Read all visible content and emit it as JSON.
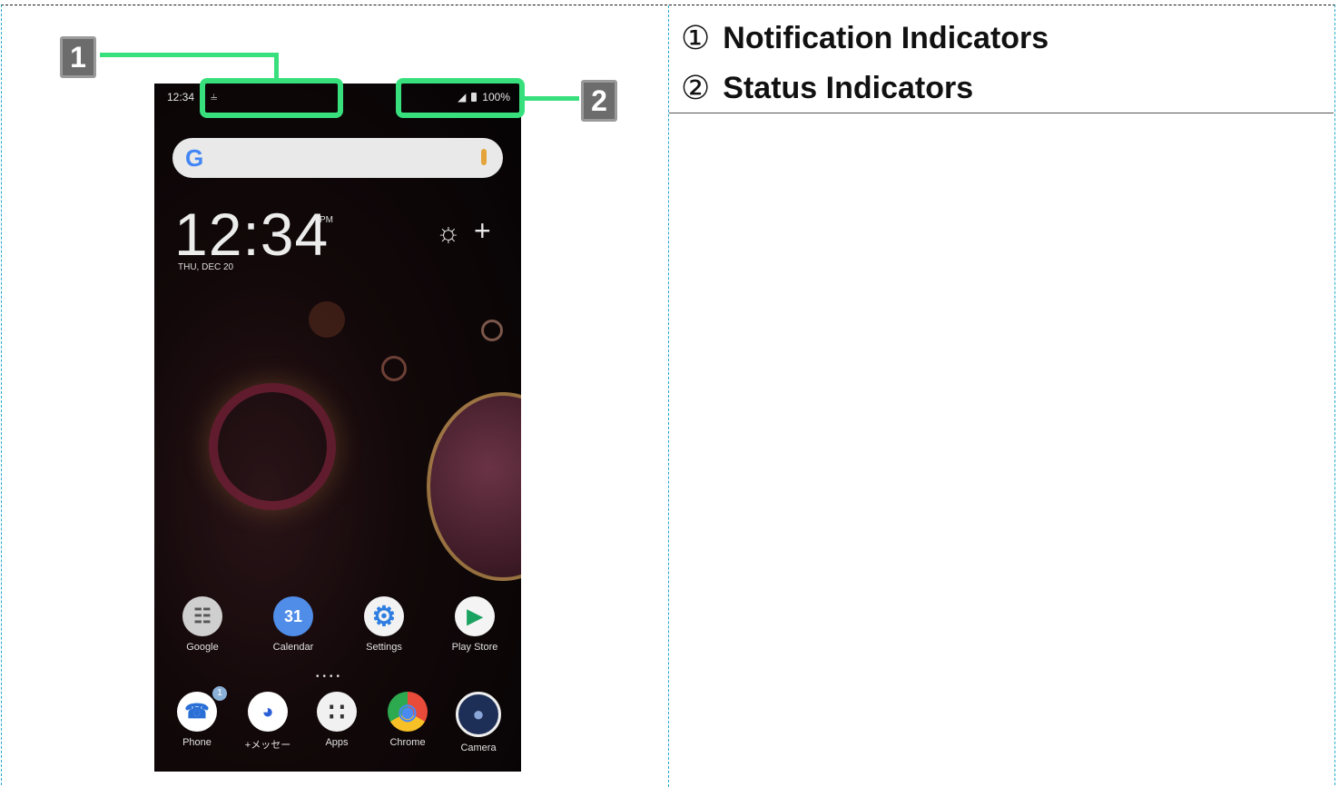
{
  "legend": {
    "item1": {
      "num": "①",
      "label": "Notification Indicators"
    },
    "item2": {
      "num": "②",
      "label": "Status Indicators"
    }
  },
  "callouts": {
    "one": "1",
    "two": "2"
  },
  "phone": {
    "status_time": "12:34",
    "status_right": "100%",
    "clock": "12:34",
    "ampm": "PM",
    "date": "THU, DEC 20",
    "apps_row1": [
      {
        "label": "Google",
        "icon": "google-folder-icon",
        "color": "#cfcfcf"
      },
      {
        "label": "Calendar",
        "icon": "calendar-icon",
        "color": "#4f8de8",
        "glyph": "31"
      },
      {
        "label": "Settings",
        "icon": "gear-icon",
        "color": "#f2f2f2",
        "glyph": "⚙"
      },
      {
        "label": "Play Store",
        "icon": "play-store-icon",
        "color": "#f4f4f4",
        "glyph": "▶"
      }
    ],
    "apps_row2": [
      {
        "label": "Phone",
        "icon": "phone-icon",
        "color": "#ffffff",
        "glyph": "☎",
        "badge": "1"
      },
      {
        "label": "+メッセー",
        "icon": "message-icon",
        "color": "#ffffff",
        "glyph": "◕"
      },
      {
        "label": "Apps",
        "icon": "apps-grid-icon",
        "color": "#f1f1f1",
        "glyph": "∷"
      },
      {
        "label": "Chrome",
        "icon": "chrome-icon",
        "color": "#e84b3a",
        "glyph": "◉"
      },
      {
        "label": "Camera",
        "icon": "camera-icon",
        "color": "#1e2f57",
        "glyph": "●"
      }
    ]
  },
  "colors": {
    "highlight": "#37e07c",
    "callout_bg": "#6c6c6c"
  }
}
